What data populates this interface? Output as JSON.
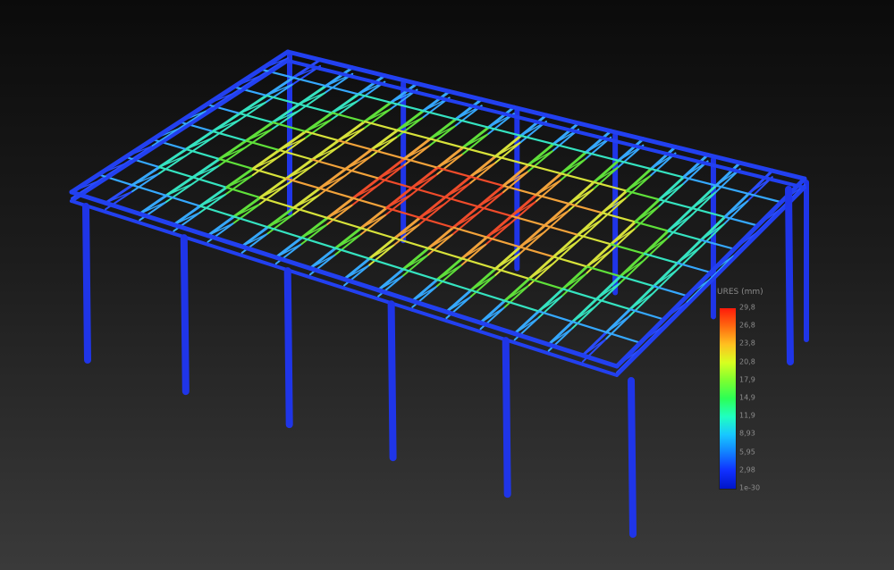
{
  "viewport": {
    "background_top": "#0b0b0b",
    "background_bottom": "#3a3a3a"
  },
  "structure": {
    "column_color": "#1f35e8",
    "frame_color": "#2240f0",
    "truss_colors_by_level": [
      "#2a4cff",
      "#35a8ff",
      "#35e3c0",
      "#5fe03a",
      "#d7e23a",
      "#f2a23a",
      "#f04b2a"
    ]
  },
  "legend": {
    "title": "URES (mm)",
    "labels": [
      "29,8",
      "26,8",
      "23,8",
      "20,8",
      "17,9",
      "14,9",
      "11,9",
      "8,93",
      "5,95",
      "2,98",
      "1e-30"
    ],
    "colors": [
      "#ff1a0a",
      "#ff6a10",
      "#ffc020",
      "#d8ff20",
      "#7dff30",
      "#2cff55",
      "#20ffc0",
      "#18c8ff",
      "#1280ff",
      "#1030ff",
      "#0015c8"
    ]
  }
}
